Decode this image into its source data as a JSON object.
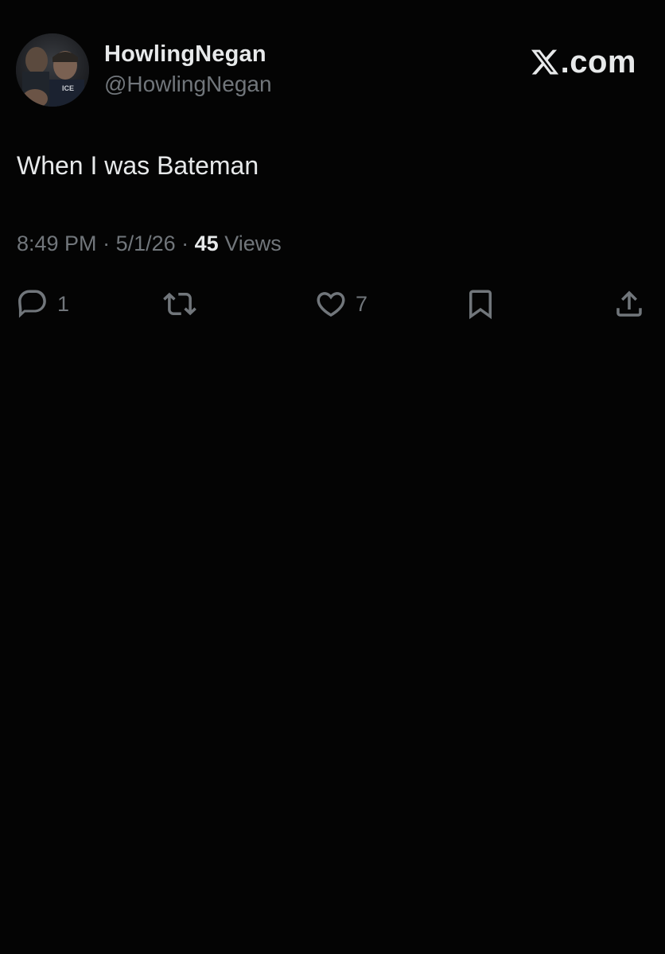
{
  "tweet": {
    "author": {
      "display_name": "HowlingNegan",
      "handle": "@HowlingNegan",
      "avatar_badge_text": "ICE"
    },
    "brand": {
      "icon": "x-logo-icon",
      "text": ".com"
    },
    "text": "When I was Bateman",
    "meta": {
      "time": "8:49 PM",
      "separator": " · ",
      "date": "5/1/26",
      "views_count": "45",
      "views_label": "Views"
    },
    "actions": {
      "reply": {
        "icon": "reply-icon",
        "count": "1"
      },
      "retweet": {
        "icon": "retweet-icon"
      },
      "like": {
        "icon": "heart-icon",
        "count": "7"
      },
      "bookmark": {
        "icon": "bookmark-icon"
      },
      "share": {
        "icon": "share-icon"
      }
    }
  },
  "colors": {
    "background": "#040404",
    "text_primary": "#e7e9ea",
    "text_secondary": "#71767b"
  }
}
